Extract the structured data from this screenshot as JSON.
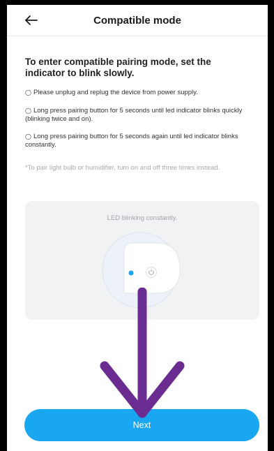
{
  "header": {
    "title": "Compatible mode",
    "back_icon": "arrow-left-icon"
  },
  "instructions": {
    "heading": "To enter compatible pairing mode, set the indicator to blink slowly.",
    "steps": [
      {
        "icon": "circle-bullet-icon",
        "text": "Please unplug and replug the device from power supply."
      },
      {
        "icon": "circle-bullet-icon",
        "text": "Long press pairing button for 5 seconds until led indicator blinks quickly (blinking twice and on)."
      },
      {
        "icon": "circle-bullet-icon",
        "text": "Long press pairing button for 5 seconds again until led indicator blinks constantly."
      }
    ],
    "note": "*To pair light bulb or humidifier, turn on and off three times instead."
  },
  "illustration": {
    "caption": "LED blinking constantly.",
    "led_color": "#1aa7f1",
    "device_icon": "smart-plug-icon",
    "power_icon": "power-icon"
  },
  "footer": {
    "next_label": "Next",
    "button_color": "#1aa7f1"
  },
  "overlay": {
    "arrow_color": "#6b2c91",
    "arrow_icon": "down-arrow-icon"
  }
}
